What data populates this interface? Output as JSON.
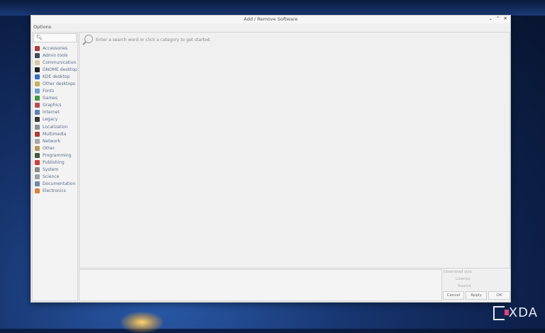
{
  "window": {
    "title": "Add / Remove Software",
    "controls": [
      "⌄",
      "⌃",
      "✕"
    ]
  },
  "menu": {
    "options_label": "Options"
  },
  "search": {
    "value": ""
  },
  "categories": [
    {
      "label": "Accessories",
      "icon": "accessories-icon",
      "color": "#b03a3a"
    },
    {
      "label": "Admin tools",
      "icon": "admin-tools-icon",
      "color": "#444b58"
    },
    {
      "label": "Communication",
      "icon": "communication-icon",
      "color": "#d9c7a0"
    },
    {
      "label": "GNOME desktop",
      "icon": "gnome-icon",
      "color": "#222222"
    },
    {
      "label": "KDE desktop",
      "icon": "kde-icon",
      "color": "#2f6fc9"
    },
    {
      "label": "Other desktops",
      "icon": "other-desktops-icon",
      "color": "#c8b25e"
    },
    {
      "label": "Fonts",
      "icon": "fonts-icon",
      "color": "#6aa0d8"
    },
    {
      "label": "Games",
      "icon": "games-icon",
      "color": "#3f9a3f"
    },
    {
      "label": "Graphics",
      "icon": "graphics-icon",
      "color": "#c04b4b"
    },
    {
      "label": "Internet",
      "icon": "internet-icon",
      "color": "#5b7fb8"
    },
    {
      "label": "Legacy",
      "icon": "legacy-icon",
      "color": "#3a3a3a"
    },
    {
      "label": "Localization",
      "icon": "localization-icon",
      "color": "#8f8f8f"
    },
    {
      "label": "Multimedia",
      "icon": "multimedia-icon",
      "color": "#b33a3a"
    },
    {
      "label": "Network",
      "icon": "network-icon",
      "color": "#a8a8a8"
    },
    {
      "label": "Other",
      "icon": "other-icon",
      "color": "#b59b5a"
    },
    {
      "label": "Programming",
      "icon": "programming-icon",
      "color": "#3d5e3d"
    },
    {
      "label": "Publishing",
      "icon": "publishing-icon",
      "color": "#d23b3b"
    },
    {
      "label": "System",
      "icon": "system-icon",
      "color": "#8a8a8a"
    },
    {
      "label": "Science",
      "icon": "science-icon",
      "color": "#9aa4a8"
    },
    {
      "label": "Documentation",
      "icon": "documentation-icon",
      "color": "#6e88b0"
    },
    {
      "label": "Electronics",
      "icon": "electronics-icon",
      "color": "#d8833a"
    }
  ],
  "main": {
    "hint": "Enter a search word or click a category to get started."
  },
  "info": {
    "download_size": "Download size",
    "license": "License",
    "source": "Source"
  },
  "buttons": {
    "cancel": "Cancel",
    "apply": "Apply",
    "ok": "OK"
  },
  "watermark": {
    "text": "XDA"
  },
  "colors": {
    "accent": "#e0457b",
    "category_text": "#5a6c8a"
  }
}
